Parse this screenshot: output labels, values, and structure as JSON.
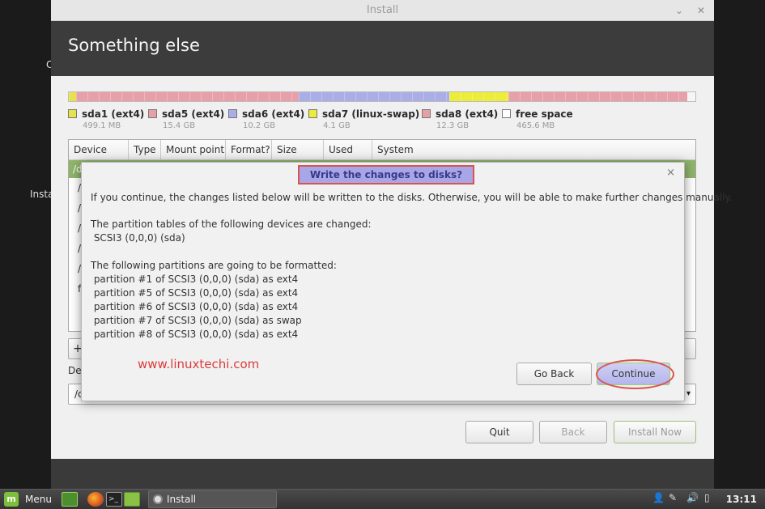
{
  "desktop": {
    "fragment_top": "C",
    "fragment_mid": "Insta"
  },
  "window": {
    "title": "Install",
    "minimize": "⌄",
    "close": "✕",
    "header": "Something else"
  },
  "partition_bar": [
    {
      "color": "#e6e24a",
      "fraction": 0.012
    },
    {
      "color": "#e8a0a8",
      "fraction": 0.355
    },
    {
      "color": "#a9aee6",
      "fraction": 0.24
    },
    {
      "color": "#ecec3a",
      "fraction": 0.095
    },
    {
      "color": "#e8a0a8",
      "fraction": 0.285
    },
    {
      "color": "#f5f5f5",
      "fraction": 0.013
    }
  ],
  "legend": [
    {
      "name": "sda1 (ext4)",
      "size": "499.1 MB",
      "color": "#e6e24a"
    },
    {
      "name": "sda5 (ext4)",
      "size": "15.4 GB",
      "color": "#e8a0a8"
    },
    {
      "name": "sda6 (ext4)",
      "size": "10.2 GB",
      "color": "#a9aee6"
    },
    {
      "name": "sda7 (linux-swap)",
      "size": "4.1 GB",
      "color": "#ecec3a"
    },
    {
      "name": "sda8 (ext4)",
      "size": "12.3 GB",
      "color": "#e8a0a8"
    },
    {
      "name": "free space",
      "size": "465.6 MB",
      "color": "#ffffff"
    }
  ],
  "table": {
    "columns": [
      "Device",
      "Type",
      "Mount point",
      "Format?",
      "Size",
      "Used",
      "System"
    ],
    "selected_row": "/d",
    "rows": [
      "/",
      "/",
      "/",
      "/",
      "/",
      "f"
    ]
  },
  "controls": {
    "add": "+",
    "device_label": "De",
    "device_value": "/c",
    "combo_arrow": "▾"
  },
  "buttons": {
    "quit": "Quit",
    "back": "Back",
    "install_now": "Install Now"
  },
  "dialog": {
    "title": "Write the changes to disks?",
    "close": "×",
    "intro": "If you continue, the changes listed below will be written to the disks. Otherwise, you will be able to make further changes manually.",
    "tables_heading": "The partition tables of the following devices are changed:",
    "tables_device": " SCSI3 (0,0,0) (sda)",
    "format_heading": "The following partitions are going to be formatted:",
    "format_items": [
      " partition #1 of SCSI3 (0,0,0) (sda) as ext4",
      " partition #5 of SCSI3 (0,0,0) (sda) as ext4",
      " partition #6 of SCSI3 (0,0,0) (sda) as ext4",
      " partition #7 of SCSI3 (0,0,0) (sda) as swap",
      " partition #8 of SCSI3 (0,0,0) (sda) as ext4"
    ],
    "watermark": "www.linuxtechi.com",
    "go_back": "Go Back",
    "continue": "Continue"
  },
  "taskbar": {
    "menu": "Menu",
    "task": "Install",
    "clock": "13:11"
  }
}
